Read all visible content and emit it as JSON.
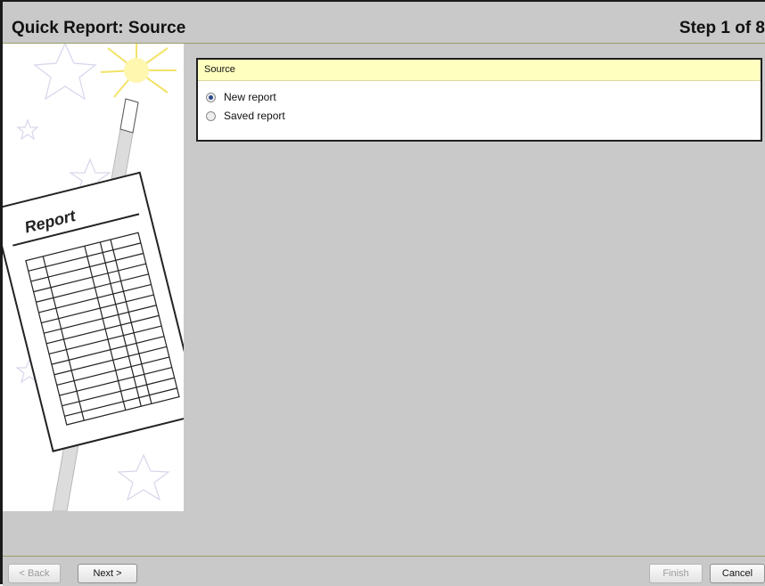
{
  "header": {
    "title": "Quick Report: Source",
    "step": "Step 1 of 8"
  },
  "sidebar": {
    "illustration_text": "Report"
  },
  "panel": {
    "heading": "Source",
    "options": [
      {
        "label": "New report",
        "selected": true
      },
      {
        "label": "Saved report",
        "selected": false
      }
    ]
  },
  "footer": {
    "back_label": "< Back",
    "next_label": "Next >",
    "finish_label": "Finish",
    "cancel_label": "Cancel"
  },
  "colors": {
    "panel_header": "#ffffc0",
    "background": "#c9c9c9",
    "radio_selected": "#2c4a8c"
  }
}
